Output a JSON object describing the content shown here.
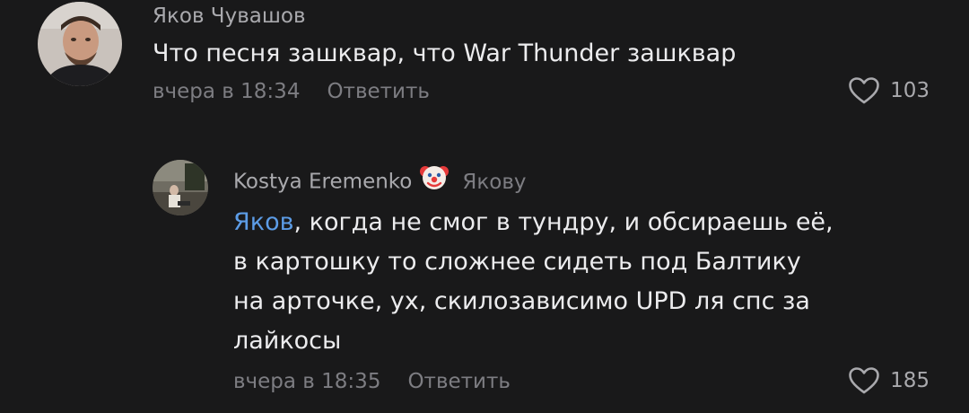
{
  "comments": [
    {
      "author": "Яков Чувашов",
      "text": "Что песня зашквар, что War Thunder зашквар",
      "time": "вчера в 18:34",
      "reply_label": "Ответить",
      "likes": "103"
    },
    {
      "author": "Kostya Eremenko",
      "reply_to": "Якову",
      "mention": "Яков",
      "text_lines": [
        ", когда не смог в тундру, и обсираешь её,",
        "в картошку то сложнее сидеть под Балтику",
        "на арточке, ух, скилозависимо UPD ля спс за",
        "лайкосы"
      ],
      "time": "вчера в 18:35",
      "reply_label": "Ответить",
      "likes": "185",
      "badge_icon": "clown-face-icon"
    }
  ],
  "colors": {
    "background": "#19191a",
    "mention": "#5c9ce6",
    "text": "#ececee",
    "muted": "#7d7d82"
  }
}
